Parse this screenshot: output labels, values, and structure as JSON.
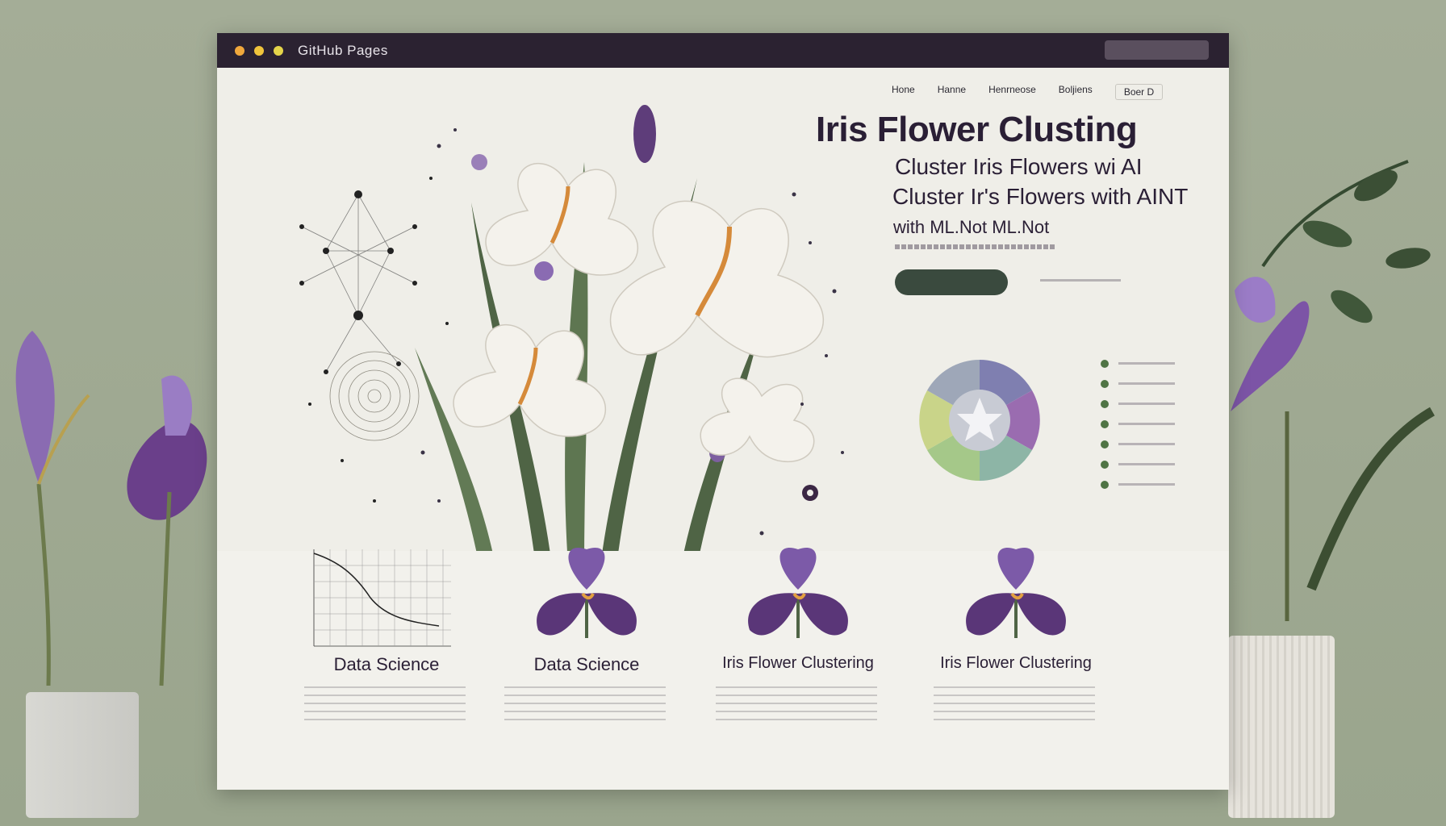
{
  "window": {
    "title": "GitHub Pages",
    "search_placeholder": "",
    "top_link": "",
    "top_link2": ""
  },
  "nav": {
    "items": [
      "Hone",
      "Hanne",
      "Henrneose",
      "Boljiens"
    ],
    "button_label": "Boer D"
  },
  "hero": {
    "title": "Iris Flower Clusting",
    "subtitle_1": "Cluster Iris Flowers wi AI",
    "subtitle_2": "Cluster Ir's Flowers with AINT",
    "subtitle_3_left": "with ML.Not",
    "subtitle_3_right": "ML.Not",
    "subtitle_3_small": "",
    "cta_label": ""
  },
  "cards": [
    {
      "title": "Data Science",
      "image": "line-chart"
    },
    {
      "title": "Data Science",
      "image": "iris-flower"
    },
    {
      "title": "Iris Flower Clustering",
      "image": "iris-flower"
    },
    {
      "title": "Iris Flower Clustering",
      "image": "iris-flower"
    }
  ],
  "colors": {
    "titlebar": "#2b2231",
    "iris_purple": "#6a3f8a",
    "leaf_green": "#556b4f",
    "cta_green": "#3a4a3e",
    "background": "#9ea893"
  }
}
